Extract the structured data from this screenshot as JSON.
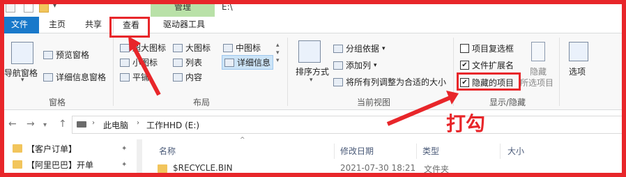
{
  "window": {
    "address_title": "E:\\"
  },
  "ribbon_tabs": {
    "file": "文件",
    "home": "主页",
    "share": "共享",
    "view": "查看",
    "drive_tools": "驱动器工具",
    "manage": "管理"
  },
  "panes": {
    "nav_pane": "导航窗格",
    "preview_pane": "预览窗格",
    "details_pane": "详细信息窗格",
    "group_label": "窗格"
  },
  "layout": {
    "extra_large": "超大图标",
    "large": "大图标",
    "medium": "中图标",
    "small": "小图标",
    "list": "列表",
    "details": "详细信息",
    "tiles": "平铺",
    "content": "内容",
    "group_label": "布局"
  },
  "current_view": {
    "sort_by": "排序方式",
    "group_by": "分组依据",
    "add_columns": "添加列",
    "size_all_columns": "将所有列调整为合适的大小",
    "group_label": "当前视图"
  },
  "show_hide": {
    "item_checkboxes": "项目复选框",
    "file_extensions": "文件扩展名",
    "hidden_items": "隐藏的项目",
    "hide_selected": "隐藏",
    "hide_selected_sub": "所选项目",
    "options": "选项",
    "group_label": "显示/隐藏",
    "item_checkboxes_checked": false,
    "file_extensions_checked": true,
    "hidden_items_checked": true
  },
  "address": {
    "crumbs": [
      "此电脑",
      "工作HHD (E:)"
    ]
  },
  "nav_items": [
    {
      "label": "【客户订单】"
    },
    {
      "label": "【阿里巴巴】开单"
    }
  ],
  "columns": [
    "名称",
    "修改日期",
    "类型",
    "大小"
  ],
  "files": [
    {
      "name": "$RECYCLE.BIN",
      "modified": "2021-07-30 18:21",
      "type": "文件夹"
    }
  ],
  "annotation": {
    "text": "打勾",
    "color": "#e8262a"
  },
  "colors": {
    "file_tab": "#1979ca",
    "manage_tab": "#b9e1a8",
    "folder": "#f2c55c"
  }
}
